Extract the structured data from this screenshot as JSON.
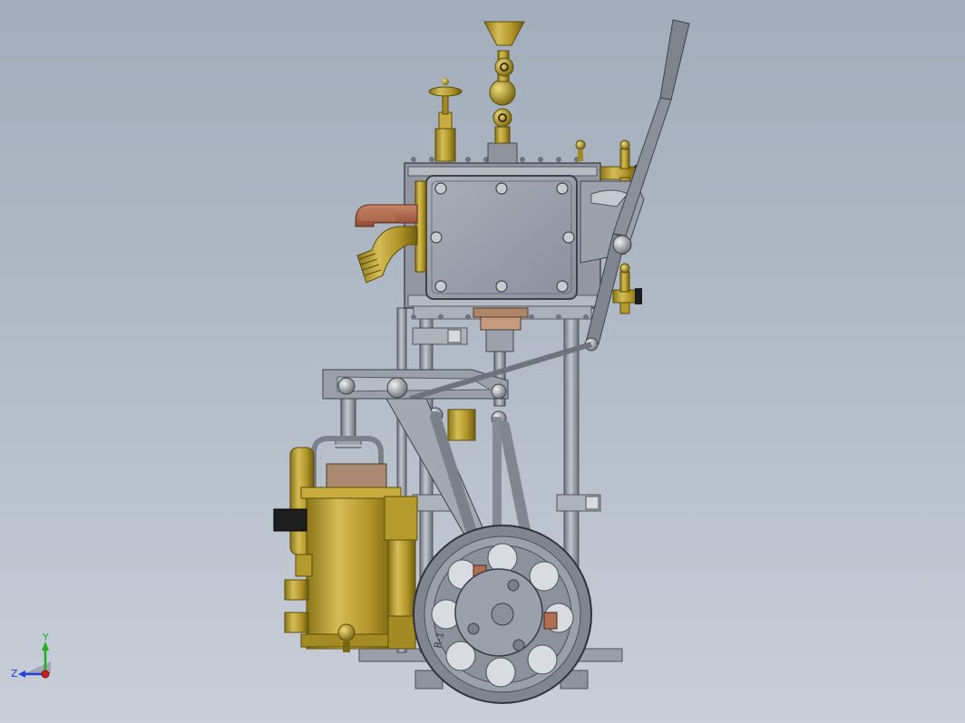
{
  "viewport": {
    "background_top": "#a2adbb",
    "background_bottom": "#c9cfd8"
  },
  "model": {
    "colors": {
      "brass": "#b59a2c",
      "brass_dark": "#7f6a14",
      "steel": "#9aa1ad",
      "steel_dark": "#5b616c",
      "copper": "#b06a4e",
      "rod": "#8a8f98",
      "flywheel": "#8f959e"
    }
  },
  "triad": {
    "y_label": "Y",
    "z_label": "Z",
    "colors": {
      "x": "#d01e1e",
      "y": "#1fb01f",
      "z": "#2244dd"
    }
  },
  "flywheel_text": "R-1"
}
